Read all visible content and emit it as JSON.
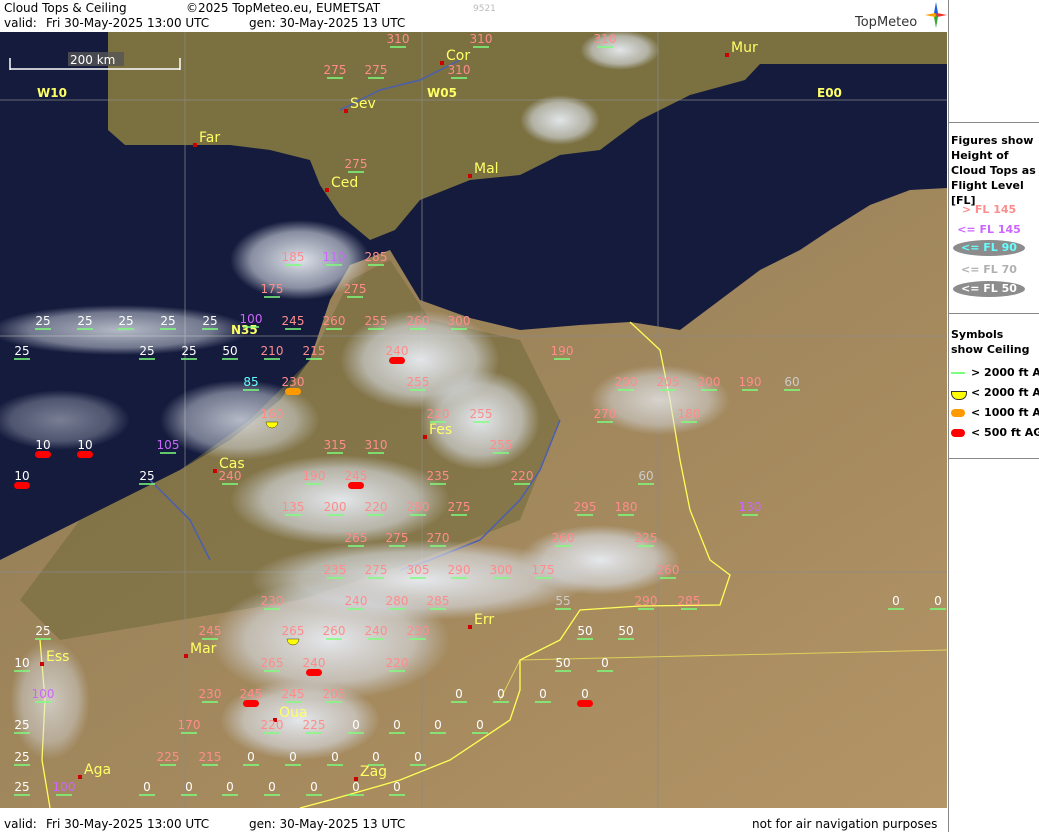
{
  "header": {
    "title": "Cloud Tops & Ceiling",
    "copyright": "©2025 TopMeteo.eu, EUMETSAT",
    "valid_label": "valid:",
    "valid_time": "Fri  30-May-2025  13:00 UTC",
    "gen": "gen: 30-May-2025 13 UTC",
    "code": "9521",
    "logo": "TopMeteo"
  },
  "footer": {
    "valid_label": "valid:",
    "valid_time": "Fri  30-May-2025  13:00 UTC",
    "gen": "gen: 30-May-2025 13 UTC",
    "note": "not for air navigation purposes"
  },
  "scale_label": "200 km",
  "grid_labels": [
    "W10",
    "W05",
    "E00",
    "N35"
  ],
  "cities": [
    {
      "name": "Far"
    },
    {
      "name": "Sev"
    },
    {
      "name": "Cor"
    },
    {
      "name": "Mur"
    },
    {
      "name": "Ced"
    },
    {
      "name": "Mal"
    },
    {
      "name": "Fes"
    },
    {
      "name": "Cas"
    },
    {
      "name": "Mar"
    },
    {
      "name": "Err"
    },
    {
      "name": "Ess"
    },
    {
      "name": "Oua"
    },
    {
      "name": "Aga"
    },
    {
      "name": "Zag"
    }
  ],
  "legend": {
    "figures_title": "Figures show Height of Cloud Tops as Flight Level  [FL]",
    "fl_items": [
      {
        "label": "> FL 145",
        "color": "#ff8c8c",
        "oval": false
      },
      {
        "label": "<= FL 145",
        "color": "#cc66ff",
        "oval": false
      },
      {
        "label": "<= FL 90",
        "color": "#66ffff",
        "oval": true
      },
      {
        "label": "<= FL 70",
        "color": "#b0b0b0",
        "oval": false
      },
      {
        "label": "<= FL 50",
        "color": "#ffffff",
        "oval": true
      }
    ],
    "symbols_title": "Symbols show Ceiling",
    "ceiling_items": [
      {
        "label": "> 2000 ft AGL",
        "color": "#7cff7c",
        "shape": "line"
      },
      {
        "label": "< 2000 ft AGL",
        "color": "#ffff00",
        "shape": "half"
      },
      {
        "label": "< 1000 ft AGL",
        "color": "#ff9900",
        "shape": "pill"
      },
      {
        "label": "< 500 ft AGL",
        "color": "#ff0000",
        "shape": "pill"
      }
    ]
  },
  "colors": {
    "high": "#ff8c8c",
    "mid": "#cc66ff",
    "low": "#66ffff",
    "lower": "#cccccc",
    "lowest": "#ffffff",
    "ceil_ok": "#7cff7c",
    "ceil_2000": "#ffff00",
    "ceil_1000": "#ff9900",
    "ceil_500": "#ff0000"
  },
  "markers": [
    {
      "v": "310",
      "c": "high"
    },
    {
      "v": "310",
      "c": "high"
    },
    {
      "v": "310",
      "c": "high"
    },
    {
      "v": "275",
      "c": "high"
    },
    {
      "v": "275",
      "c": "high"
    },
    {
      "v": "310",
      "c": "high"
    },
    {
      "v": "275",
      "c": "high"
    },
    {
      "v": "185",
      "c": "high"
    },
    {
      "v": "110",
      "c": "mid"
    },
    {
      "v": "285",
      "c": "high"
    },
    {
      "v": "175",
      "c": "high"
    },
    {
      "v": "275",
      "c": "high"
    },
    {
      "v": "25",
      "c": "lowest"
    },
    {
      "v": "25",
      "c": "lowest"
    },
    {
      "v": "25",
      "c": "lowest"
    },
    {
      "v": "25",
      "c": "lowest"
    },
    {
      "v": "25",
      "c": "lowest"
    },
    {
      "v": "100",
      "c": "mid"
    },
    {
      "v": "245",
      "c": "high"
    },
    {
      "v": "260",
      "c": "high"
    },
    {
      "v": "255",
      "c": "high"
    },
    {
      "v": "260",
      "c": "high"
    },
    {
      "v": "300",
      "c": "high"
    },
    {
      "v": "25",
      "c": "lowest"
    },
    {
      "v": "25",
      "c": "lowest"
    },
    {
      "v": "25",
      "c": "lowest"
    },
    {
      "v": "50",
      "c": "lowest"
    },
    {
      "v": "210",
      "c": "high"
    },
    {
      "v": "215",
      "c": "high"
    },
    {
      "v": "240",
      "c": "high"
    },
    {
      "v": "190",
      "c": "high"
    },
    {
      "v": "85",
      "c": "low"
    },
    {
      "v": "230",
      "c": "high"
    },
    {
      "v": "255",
      "c": "high"
    },
    {
      "v": "200",
      "c": "high"
    },
    {
      "v": "205",
      "c": "high"
    },
    {
      "v": "200",
      "c": "high"
    },
    {
      "v": "190",
      "c": "high"
    },
    {
      "v": "60",
      "c": "lower"
    },
    {
      "v": "160",
      "c": "high"
    },
    {
      "v": "220",
      "c": "high"
    },
    {
      "v": "255",
      "c": "high"
    },
    {
      "v": "270",
      "c": "high"
    },
    {
      "v": "180",
      "c": "high"
    },
    {
      "v": "10",
      "c": "lowest"
    },
    {
      "v": "10",
      "c": "lowest"
    },
    {
      "v": "105",
      "c": "mid"
    },
    {
      "v": "315",
      "c": "high"
    },
    {
      "v": "310",
      "c": "high"
    },
    {
      "v": "255",
      "c": "high"
    },
    {
      "v": "10",
      "c": "lowest"
    },
    {
      "v": "25",
      "c": "lowest"
    },
    {
      "v": "240",
      "c": "high"
    },
    {
      "v": "190",
      "c": "high"
    },
    {
      "v": "245",
      "c": "high"
    },
    {
      "v": "235",
      "c": "high"
    },
    {
      "v": "220",
      "c": "high"
    },
    {
      "v": "60",
      "c": "lower"
    },
    {
      "v": "135",
      "c": "high"
    },
    {
      "v": "200",
      "c": "high"
    },
    {
      "v": "220",
      "c": "high"
    },
    {
      "v": "280",
      "c": "high"
    },
    {
      "v": "275",
      "c": "high"
    },
    {
      "v": "295",
      "c": "high"
    },
    {
      "v": "180",
      "c": "high"
    },
    {
      "v": "130",
      "c": "mid"
    },
    {
      "v": "265",
      "c": "high"
    },
    {
      "v": "275",
      "c": "high"
    },
    {
      "v": "270",
      "c": "high"
    },
    {
      "v": "260",
      "c": "high"
    },
    {
      "v": "225",
      "c": "high"
    },
    {
      "v": "235",
      "c": "high"
    },
    {
      "v": "275",
      "c": "high"
    },
    {
      "v": "305",
      "c": "high"
    },
    {
      "v": "290",
      "c": "high"
    },
    {
      "v": "300",
      "c": "high"
    },
    {
      "v": "175",
      "c": "high"
    },
    {
      "v": "260",
      "c": "high"
    },
    {
      "v": "230",
      "c": "high"
    },
    {
      "v": "240",
      "c": "high"
    },
    {
      "v": "280",
      "c": "high"
    },
    {
      "v": "285",
      "c": "high"
    },
    {
      "v": "55",
      "c": "lower"
    },
    {
      "v": "290",
      "c": "high"
    },
    {
      "v": "285",
      "c": "high"
    },
    {
      "v": "0",
      "c": "lowest"
    },
    {
      "v": "0",
      "c": "lowest"
    },
    {
      "v": "25",
      "c": "lowest"
    },
    {
      "v": "245",
      "c": "high"
    },
    {
      "v": "265",
      "c": "high"
    },
    {
      "v": "260",
      "c": "high"
    },
    {
      "v": "240",
      "c": "high"
    },
    {
      "v": "230",
      "c": "high"
    },
    {
      "v": "50",
      "c": "lowest"
    },
    {
      "v": "50",
      "c": "lowest"
    },
    {
      "v": "10",
      "c": "lowest"
    },
    {
      "v": "265",
      "c": "high"
    },
    {
      "v": "240",
      "c": "high"
    },
    {
      "v": "220",
      "c": "high"
    },
    {
      "v": "50",
      "c": "lowest"
    },
    {
      "v": "0",
      "c": "lowest"
    },
    {
      "v": "100",
      "c": "mid"
    },
    {
      "v": "230",
      "c": "high"
    },
    {
      "v": "245",
      "c": "high"
    },
    {
      "v": "245",
      "c": "high"
    },
    {
      "v": "205",
      "c": "high"
    },
    {
      "v": "0",
      "c": "lowest"
    },
    {
      "v": "0",
      "c": "lowest"
    },
    {
      "v": "0",
      "c": "lowest"
    },
    {
      "v": "0",
      "c": "lowest"
    },
    {
      "v": "25",
      "c": "lowest"
    },
    {
      "v": "170",
      "c": "high"
    },
    {
      "v": "220",
      "c": "high"
    },
    {
      "v": "225",
      "c": "high"
    },
    {
      "v": "0",
      "c": "lowest"
    },
    {
      "v": "0",
      "c": "lowest"
    },
    {
      "v": "0",
      "c": "lowest"
    },
    {
      "v": "0",
      "c": "lowest"
    },
    {
      "v": "25",
      "c": "lowest"
    },
    {
      "v": "225",
      "c": "high"
    },
    {
      "v": "215",
      "c": "high"
    },
    {
      "v": "0",
      "c": "lowest"
    },
    {
      "v": "0",
      "c": "lowest"
    },
    {
      "v": "0",
      "c": "lowest"
    },
    {
      "v": "0",
      "c": "lowest"
    },
    {
      "v": "0",
      "c": "lowest"
    },
    {
      "v": "25",
      "c": "lowest"
    },
    {
      "v": "100",
      "c": "mid"
    },
    {
      "v": "0",
      "c": "lowest"
    },
    {
      "v": "0",
      "c": "lowest"
    },
    {
      "v": "0",
      "c": "lowest"
    },
    {
      "v": "0",
      "c": "lowest"
    },
    {
      "v": "0",
      "c": "lowest"
    },
    {
      "v": "0",
      "c": "lowest"
    },
    {
      "v": "0",
      "c": "lowest"
    }
  ]
}
